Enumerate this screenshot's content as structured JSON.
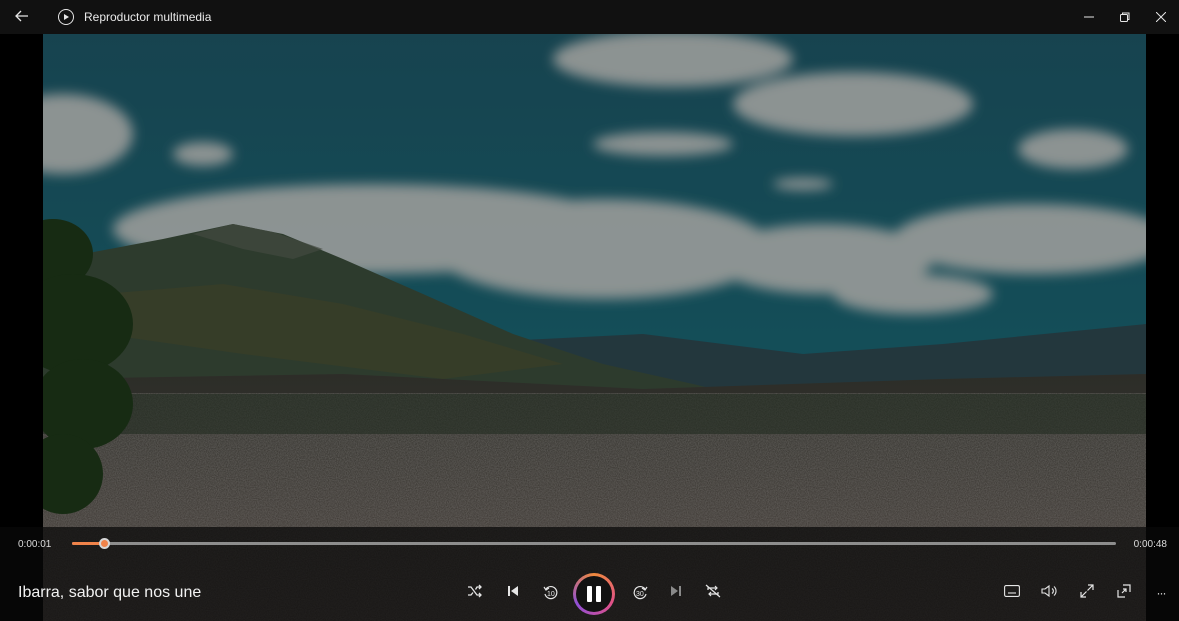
{
  "window": {
    "title": "Reproductor multimedia",
    "icons": {
      "back": "arrow-left-icon",
      "app": "play-circle-icon",
      "minimize": "minimize-icon",
      "restore": "restore-icon",
      "close": "close-icon"
    }
  },
  "playback": {
    "current_time": "0:00:01",
    "total_time": "0:00:48",
    "progress_fraction": 0.031,
    "title": "Ibarra, sabor que nos une",
    "state": "playing"
  },
  "controls": {
    "left_group": [
      "shuffle-icon",
      "previous-icon",
      "rewind-10-icon",
      "pause-icon",
      "forward-30-icon",
      "next-icon",
      "repeat-off-icon"
    ],
    "right_group": [
      "subtitles-icon",
      "volume-icon",
      "fullscreen-icon",
      "mini-player-icon",
      "more-icon"
    ],
    "rewind_label": "10",
    "forward_label": "30",
    "more_label": "···"
  },
  "colors": {
    "accent": "#f0834a",
    "titlebar": "#141414",
    "controls_bg": "#080808"
  }
}
